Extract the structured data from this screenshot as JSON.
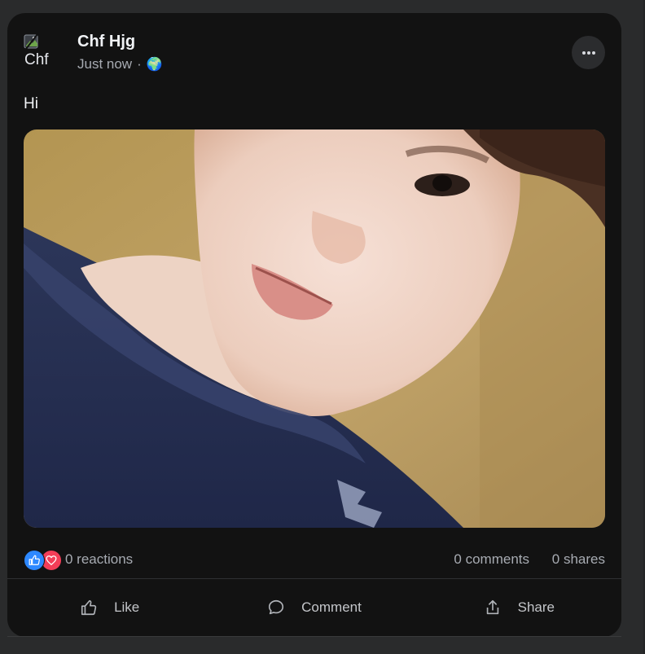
{
  "post": {
    "author": {
      "name": "Chf Hjg",
      "avatar_alt": "Chf",
      "avatar_icon": "broken-image-icon"
    },
    "timestamp": "Just now",
    "separator": "·",
    "privacy_icon": "🌍",
    "more_icon": "more-horizontal-icon",
    "text": "Hi",
    "media": {
      "icon": "photo"
    },
    "stats": {
      "reaction_icons": [
        "like-icon",
        "love-icon"
      ],
      "reactions": "0 reactions",
      "comments": "0 comments",
      "shares": "0 shares"
    },
    "actions": [
      {
        "label": "Like",
        "icon": "thumbs-up-icon"
      },
      {
        "label": "Comment",
        "icon": "comment-icon"
      },
      {
        "label": "Share",
        "icon": "share-icon"
      }
    ]
  },
  "colors": {
    "background": "#2a2b2c",
    "card": "#121212",
    "primary_text": "#f0f2f5",
    "secondary_text": "#a7abb2",
    "like_blue": "#2d88ff",
    "love_red": "#f33e58"
  }
}
